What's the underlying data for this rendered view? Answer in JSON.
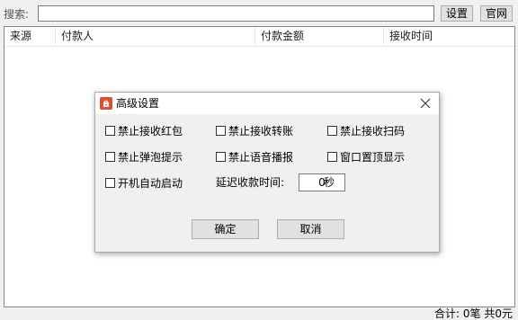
{
  "search": {
    "label": "搜索:",
    "value": "",
    "placeholder": ""
  },
  "toolbar": {
    "settings_label": "设置",
    "website_label": "官网"
  },
  "table": {
    "columns": [
      "来源",
      "付款人",
      "付款金额",
      "接收时间"
    ],
    "rows": []
  },
  "footer": {
    "summary": "合计: 0笔 共0元"
  },
  "dialog": {
    "title": "高级设置",
    "icon": "red-app-icon",
    "close_icon": "close-icon",
    "checkboxes": [
      {
        "label": "禁止接收红包",
        "checked": false
      },
      {
        "label": "禁止接收转账",
        "checked": false
      },
      {
        "label": "禁止接收扫码",
        "checked": false
      },
      {
        "label": "禁止弹泡提示",
        "checked": false
      },
      {
        "label": "禁止语音播报",
        "checked": false
      },
      {
        "label": "窗口置顶显示",
        "checked": false
      },
      {
        "label": "开机自动启动",
        "checked": false
      }
    ],
    "delay": {
      "label": "延迟收款时间:",
      "value": "0",
      "unit": "秒"
    },
    "ok_label": "确定",
    "cancel_label": "取消"
  }
}
